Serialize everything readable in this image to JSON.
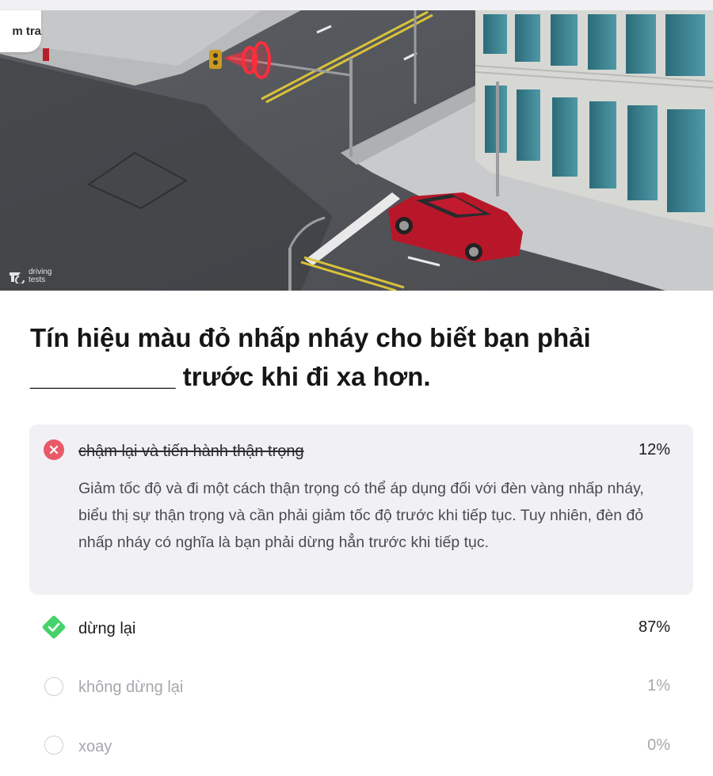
{
  "header": {
    "back_label": "m tra"
  },
  "image": {
    "watermark_line1": "driving",
    "watermark_line2": "tests"
  },
  "question": {
    "text": "Tín hiệu màu đỏ nhấp nháy cho biết bạn phải __________ trước khi đi xa hơn."
  },
  "options": [
    {
      "label": "chậm lại và tiến hành thận trọng",
      "percent": "12%",
      "state": "wrong-selected",
      "explanation": "Giảm tốc độ và đi một cách thận trọng có thể áp dụng đối với đèn vàng nhấp nháy, biểu thị sự thận trọng và cần phải giảm tốc độ trước khi tiếp tục. Tuy nhiên, đèn đỏ nhấp nháy có nghĩa là bạn phải dừng hẳn trước khi tiếp tục."
    },
    {
      "label": "dừng lại",
      "percent": "87%",
      "state": "correct"
    },
    {
      "label": "không dừng lại",
      "percent": "1%",
      "state": "unselected"
    },
    {
      "label": "xoay",
      "percent": "0%",
      "state": "unselected"
    }
  ],
  "colors": {
    "wrong": "#e95a68",
    "correct": "#46d36b",
    "explanation_bg": "#f1f1f5",
    "muted_text": "#a7a7ad"
  }
}
